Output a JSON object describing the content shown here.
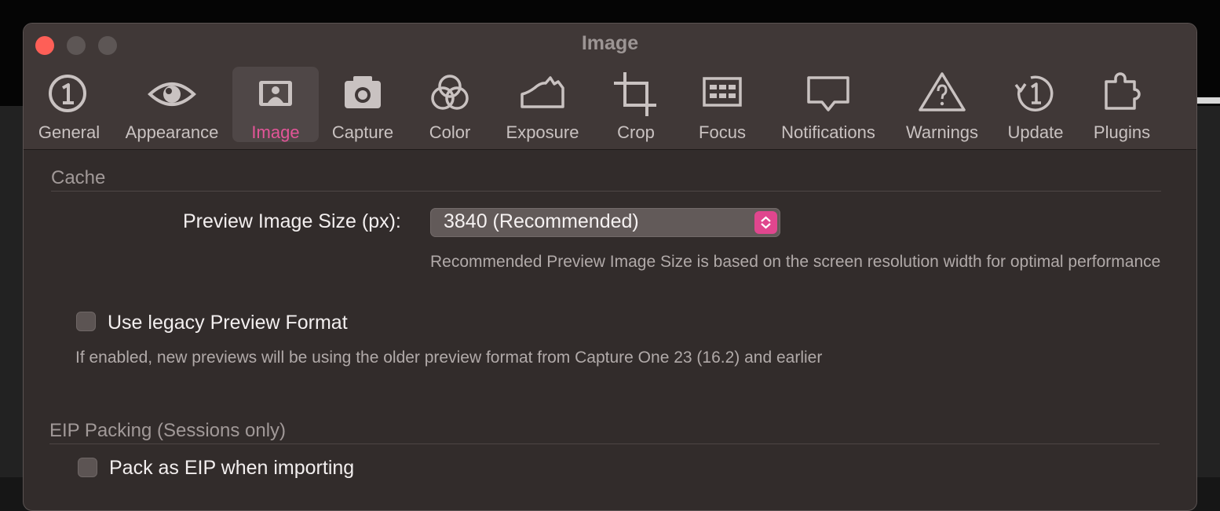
{
  "window": {
    "title": "Image"
  },
  "tabs": [
    {
      "label": "General",
      "icon": "circled-1-icon",
      "active": false
    },
    {
      "label": "Appearance",
      "icon": "eye-icon",
      "active": false
    },
    {
      "label": "Image",
      "icon": "image-portrait-icon",
      "active": true
    },
    {
      "label": "Capture",
      "icon": "camera-icon",
      "active": false
    },
    {
      "label": "Color",
      "icon": "color-circles-icon",
      "active": false
    },
    {
      "label": "Exposure",
      "icon": "exposure-histogram-icon",
      "active": false
    },
    {
      "label": "Crop",
      "icon": "crop-icon",
      "active": false
    },
    {
      "label": "Focus",
      "icon": "focus-grid-icon",
      "active": false
    },
    {
      "label": "Notifications",
      "icon": "speech-bubble-icon",
      "active": false
    },
    {
      "label": "Warnings",
      "icon": "warning-triangle-icon",
      "active": false
    },
    {
      "label": "Update",
      "icon": "update-circular-icon",
      "active": false
    },
    {
      "label": "Plugins",
      "icon": "puzzle-piece-icon",
      "active": false
    }
  ],
  "cache": {
    "header": "Cache",
    "preview_size_label": "Preview Image Size (px):",
    "preview_size_value": "3840 (Recommended)",
    "preview_size_hint": "Recommended Preview Image Size is based on the screen resolution width for optimal performance",
    "legacy_checkbox_label": "Use legacy Preview Format",
    "legacy_checked": false,
    "legacy_hint": "If enabled, new previews will be using the older preview format from Capture One 23 (16.2) and earlier"
  },
  "eip": {
    "header": "EIP Packing (Sessions only)",
    "pack_checkbox_label": "Pack as EIP when importing",
    "pack_checked": false
  },
  "colors": {
    "accent": "#e0468e",
    "active_tab_label": "#e35598",
    "close_button": "#fe5f57"
  }
}
